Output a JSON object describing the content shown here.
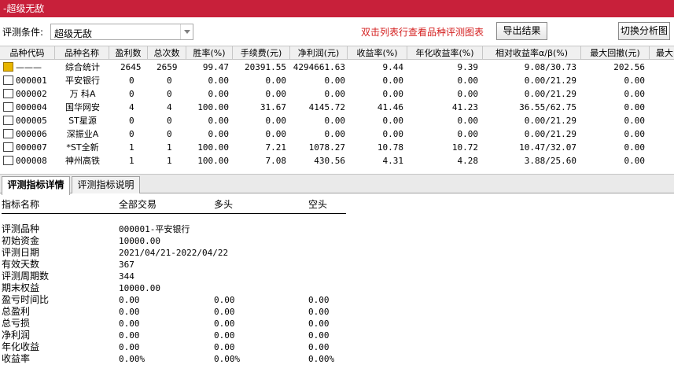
{
  "window": {
    "title": "-超级无敌"
  },
  "toolbar": {
    "condition_label": "评测条件:",
    "condition_value": "超级无敌",
    "hint": "双击列表行查看品种评测图表",
    "export_label": "导出结果",
    "switch_label": "切换分析图"
  },
  "grid": {
    "columns": [
      "品种代码",
      "品种名称",
      "盈利数",
      "总次数",
      "胜率(%)",
      "手续费(元)",
      "净利润(元)",
      "收益率(%)",
      "年化收益率(%)",
      "相对收益率α/β(%)",
      "最大回撤(元)",
      "最大"
    ],
    "rows": [
      {
        "code": "———",
        "name": "综合统计",
        "win": "2645",
        "total": "2659",
        "rate": "99.47",
        "fee": "20391.55",
        "profit": "4294661.63",
        "ret": "9.44",
        "annual": "9.39",
        "rel": "9.08/30.73",
        "dd": "202.56",
        "summary": true
      },
      {
        "code": "000001",
        "name": "平安银行",
        "win": "0",
        "total": "0",
        "rate": "0.00",
        "fee": "0.00",
        "profit": "0.00",
        "ret": "0.00",
        "annual": "0.00",
        "rel": "0.00/21.29",
        "dd": "0.00",
        "summary": false
      },
      {
        "code": "000002",
        "name": "万 科A",
        "win": "0",
        "total": "0",
        "rate": "0.00",
        "fee": "0.00",
        "profit": "0.00",
        "ret": "0.00",
        "annual": "0.00",
        "rel": "0.00/21.29",
        "dd": "0.00",
        "summary": false
      },
      {
        "code": "000004",
        "name": "国华网安",
        "win": "4",
        "total": "4",
        "rate": "100.00",
        "fee": "31.67",
        "profit": "4145.72",
        "ret": "41.46",
        "annual": "41.23",
        "rel": "36.55/62.75",
        "dd": "0.00",
        "summary": false
      },
      {
        "code": "000005",
        "name": "ST星源",
        "win": "0",
        "total": "0",
        "rate": "0.00",
        "fee": "0.00",
        "profit": "0.00",
        "ret": "0.00",
        "annual": "0.00",
        "rel": "0.00/21.29",
        "dd": "0.00",
        "summary": false
      },
      {
        "code": "000006",
        "name": "深振业A",
        "win": "0",
        "total": "0",
        "rate": "0.00",
        "fee": "0.00",
        "profit": "0.00",
        "ret": "0.00",
        "annual": "0.00",
        "rel": "0.00/21.29",
        "dd": "0.00",
        "summary": false
      },
      {
        "code": "000007",
        "name": "*ST全新",
        "win": "1",
        "total": "1",
        "rate": "100.00",
        "fee": "7.21",
        "profit": "1078.27",
        "ret": "10.78",
        "annual": "10.72",
        "rel": "10.47/32.07",
        "dd": "0.00",
        "summary": false
      },
      {
        "code": "000008",
        "name": "神州高铁",
        "win": "1",
        "total": "1",
        "rate": "100.00",
        "fee": "7.08",
        "profit": "430.56",
        "ret": "4.31",
        "annual": "4.28",
        "rel": "3.88/25.60",
        "dd": "0.00",
        "summary": false
      }
    ]
  },
  "tabs": [
    {
      "label": "评测指标详情",
      "active": true
    },
    {
      "label": "评测指标说明",
      "active": false
    }
  ],
  "detail": {
    "headers": [
      "指标名称",
      "全部交易",
      "多头",
      "空头"
    ],
    "rows": [
      {
        "label": "评测品种",
        "v1": "000001-平安银行",
        "v2": "",
        "v3": ""
      },
      {
        "label": "初始资金",
        "v1": "10000.00",
        "v2": "",
        "v3": ""
      },
      {
        "label": "评测日期",
        "v1": "2021/04/21-2022/04/22",
        "v2": "",
        "v3": ""
      },
      {
        "label": "有效天数",
        "v1": "367",
        "v2": "",
        "v3": ""
      },
      {
        "label": "评测周期数",
        "v1": "344",
        "v2": "",
        "v3": ""
      },
      {
        "label": "期末权益",
        "v1": "10000.00",
        "v2": "",
        "v3": ""
      },
      {
        "label": "盈亏时间比",
        "v1": "0.00",
        "v2": "0.00",
        "v3": "0.00"
      },
      {
        "label": "总盈利",
        "v1": "0.00",
        "v2": "0.00",
        "v3": "0.00"
      },
      {
        "label": "总亏损",
        "v1": "0.00",
        "v2": "0.00",
        "v3": "0.00"
      },
      {
        "label": "净利润",
        "v1": "0.00",
        "v2": "0.00",
        "v3": "0.00"
      },
      {
        "label": "年化收益",
        "v1": "0.00",
        "v2": "0.00",
        "v3": "0.00"
      },
      {
        "label": "收益率",
        "v1": "0.00%",
        "v2": "0.00%",
        "v3": "0.00%"
      }
    ]
  },
  "colors": {
    "titlebar": "#c8203a",
    "hint": "#d42020",
    "summary_icon": "#e8b600"
  }
}
